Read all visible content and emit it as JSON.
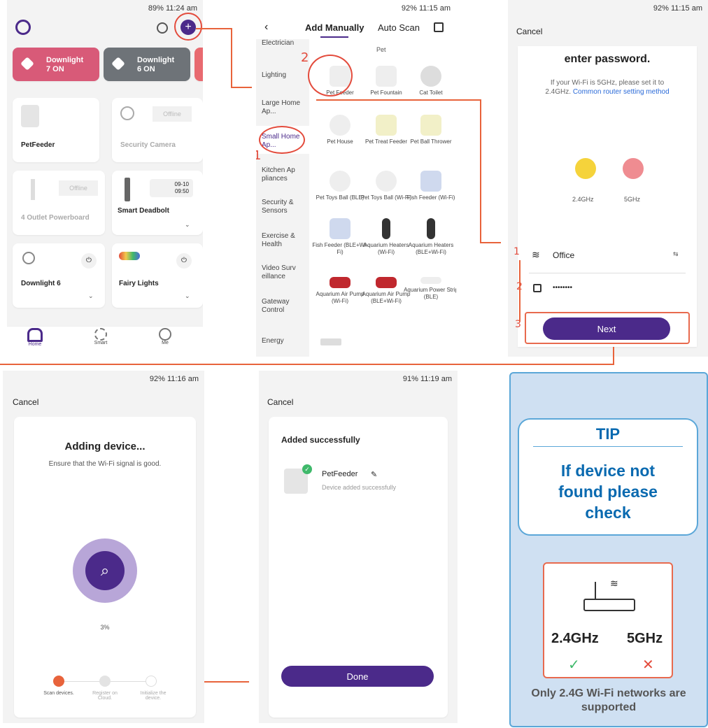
{
  "panel1": {
    "status": "89% 11:24 am",
    "scenes": [
      {
        "title": "Downlight",
        "sub": "7 ON",
        "color": "#d85a78"
      },
      {
        "title": "Downlight",
        "sub": "6 ON",
        "color": "#6e7378"
      }
    ],
    "devices": [
      {
        "name": "PetFeeder"
      },
      {
        "name": "Security Camera",
        "badge": "Offline"
      },
      {
        "name": "4 Outlet Powerboard",
        "badge": "Offline"
      },
      {
        "name": "Smart Deadbolt",
        "time1": "09-10",
        "time2": "09:50"
      },
      {
        "name": "Downlight 6"
      },
      {
        "name": "Fairy Lights"
      }
    ],
    "nav": [
      "Home",
      "Smart",
      "Me"
    ]
  },
  "panel2": {
    "status": "92% 11:15 am",
    "tab_manual": "Add Manually",
    "tab_auto": "Auto Scan",
    "categories": [
      "Electrician",
      "Lighting",
      "Large Home Ap...",
      "Small Home Ap...",
      "Kitchen Ap pliances",
      "Security & Sensors",
      "Exercise & Health",
      "Video Surv eillance",
      "Gateway Control",
      "Energy"
    ],
    "section": "Pet",
    "items": [
      {
        "label": "Pet Feeder"
      },
      {
        "label": "Pet Fountain"
      },
      {
        "label": "Cat Toilet"
      },
      {
        "label": "Pet House"
      },
      {
        "label": "Pet Treat Feeder"
      },
      {
        "label": "Pet Ball Thrower"
      },
      {
        "label": "Pet Toys Ball (BLE)"
      },
      {
        "label": "Pet Toys Ball (Wi-Fi)"
      },
      {
        "label": "Fish Feeder (Wi-Fi)"
      },
      {
        "label": "Fish Feeder (BLE+Wi-Fi)"
      },
      {
        "label": "Aquarium Heaters (Wi-Fi)"
      },
      {
        "label": "Aquarium Heaters (BLE+Wi-Fi)"
      },
      {
        "label": "Aquarium Air Pump (Wi-Fi)"
      },
      {
        "label": "Aquarium Air Pump (BLE+Wi-Fi)"
      },
      {
        "label": "Aquarium Power Strip (BLE)"
      }
    ]
  },
  "panel3": {
    "status": "92% 11:15 am",
    "cancel": "Cancel",
    "heading": "enter password.",
    "hint": "If your Wi-Fi is 5GHz, please set it to 2.4GHz.",
    "link": "Common router setting method",
    "band1": "2.4GHz",
    "band2": "5GHz",
    "ssid": "Office",
    "password": "••••••••",
    "next": "Next"
  },
  "panel4": {
    "status": "92% 11:16 am",
    "cancel": "Cancel",
    "title": "Adding device...",
    "subtitle": "Ensure that the Wi-Fi signal is good.",
    "percent": "3%",
    "steps": [
      "Scan devices.",
      "Register on Cloud.",
      "Initialize the device."
    ]
  },
  "panel5": {
    "status": "91% 11:19 am",
    "cancel": "Cancel",
    "title": "Added successfully",
    "device": "PetFeeder",
    "device_sub": "Device added successfully",
    "done": "Done"
  },
  "tip": {
    "title": "TIP",
    "message": "If device not found please check",
    "band1": "2.4GHz",
    "band2": "5GHz",
    "footer": "Only 2.4G Wi-Fi networks are supported"
  },
  "markers": [
    "1",
    "2",
    "1",
    "2",
    "3"
  ]
}
